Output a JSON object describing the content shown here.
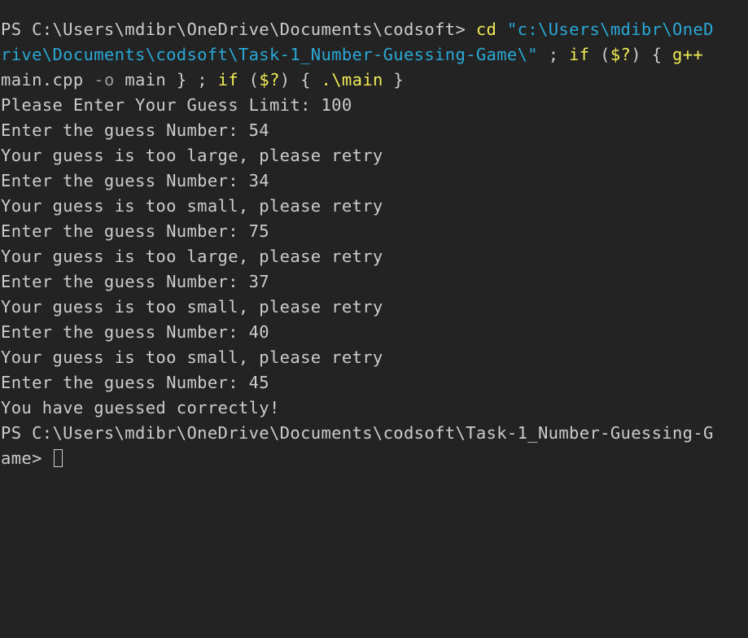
{
  "terminal": {
    "colors": {
      "background": "#232323",
      "text": "#cccccc",
      "command": "#f0ea55",
      "string": "#2aa8d6",
      "parameter": "#9a9a9a"
    },
    "command": {
      "prompt": "PS C:\\Users\\mdibr\\OneDrive\\Documents\\codsoft> ",
      "cd": "cd",
      "path_part1": "\"c:\\Users\\mdibr\\OneD",
      "path_part2": "rive\\Documents\\codsoft\\Task-1_Number-Guessing-Game\\\"",
      "sep1": " ; ",
      "if1": "if",
      "paren1_open": " (",
      "dollar1": "$?",
      "paren1_close": ") { ",
      "gpp": "g++",
      "source": "main.cpp",
      "flag_o": "-o",
      "target": "main",
      "close1": " } ; ",
      "if2": "if",
      "paren2_open": " (",
      "dollar2": "$?",
      "paren2_close": ") { ",
      "run": ".\\main",
      "close2": " }"
    },
    "output": [
      "Please Enter Your Guess Limit: 100",
      "Enter the guess Number: 54",
      "Your guess is too large, please retry",
      "Enter the guess Number: 34",
      "Your guess is too small, please retry",
      "Enter the guess Number: 75",
      "Your guess is too large, please retry",
      "Enter the guess Number: 37",
      "Your guess is too small, please retry",
      "Enter the guess Number: 40",
      "Your guess is too small, please retry",
      "Enter the guess Number: 45",
      "You have guessed correctly!"
    ],
    "final_prompt_part1": "PS C:\\Users\\mdibr\\OneDrive\\Documents\\codsoft\\Task-1_Number-Guessing-G",
    "final_prompt_part2": "ame> "
  }
}
